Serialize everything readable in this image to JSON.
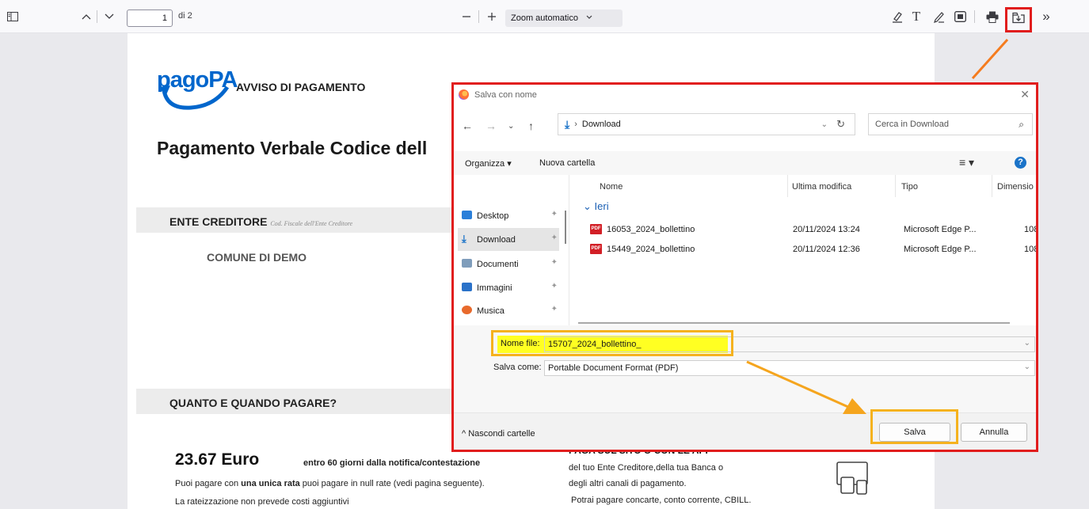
{
  "toolbar": {
    "page_number": "1",
    "page_of": "di 2",
    "zoom_label": "Zoom automatico"
  },
  "pdf": {
    "logo_text": "pagoPA",
    "avviso_title": "AVVISO DI PAGAMENTO",
    "document_title": "Pagamento Verbale Codice dell",
    "ente_heading": "ENTE CREDITORE",
    "ente_subtitle": "Cod. Fiscale dell'Ente Creditore",
    "comune": "COMUNE DI DEMO",
    "quanto_heading": "QUANTO E QUANDO PAGARE?",
    "amount": "23.67 Euro",
    "deadline": "entro 60 giorni dalla notifica/contestazione",
    "line1_pre": "Puoi pagare con ",
    "line1_bold": "una unica rata",
    "line1_post": " puoi pagare in null rate (vedi pagina seguente).",
    "line2": "La rateizzazione non prevede costi aggiuntivi",
    "paga_heading": "PAGA SUL SITO O CON LE APP",
    "paga_line1": "del tuo Ente Creditore,della tua Banca o",
    "paga_line2": "degli altri canali di pagamento.",
    "paga_line3": "Potrai pagare concarte, conto corrente, CBILL."
  },
  "dialog": {
    "title": "Salva con nome",
    "address": "Download",
    "search_placeholder": "Cerca in Download",
    "organizza": "Organizza ▾",
    "nuova_cartella": "Nuova cartella",
    "nav_items": [
      "Desktop",
      "Download",
      "Documenti",
      "Immagini",
      "Musica"
    ],
    "columns": [
      "Nome",
      "Ultima modifica",
      "Tipo",
      "Dimensio"
    ],
    "group_label": "Ieri",
    "files": [
      {
        "name": "16053_2024_bollettino",
        "modified": "20/11/2024 13:24",
        "type": "Microsoft Edge P...",
        "size": "108"
      },
      {
        "name": "15449_2024_bollettino",
        "modified": "20/11/2024 12:36",
        "type": "Microsoft Edge P...",
        "size": "108"
      }
    ],
    "filename_label": "Nome file:",
    "filename_value": "15707_2024_bollettino_",
    "saveas_label": "Salva come:",
    "saveas_value": "Portable Document Format (PDF)",
    "hide_folders": "Nascondi cartelle",
    "save_button": "Salva",
    "cancel_button": "Annulla"
  },
  "colors": {
    "highlight_red": "#e11d1d",
    "highlight_orange": "#f5b21e",
    "arrow_orange": "#f57c1f",
    "filename_yellow": "#ffff22",
    "pagopa_blue": "#0066cc"
  }
}
